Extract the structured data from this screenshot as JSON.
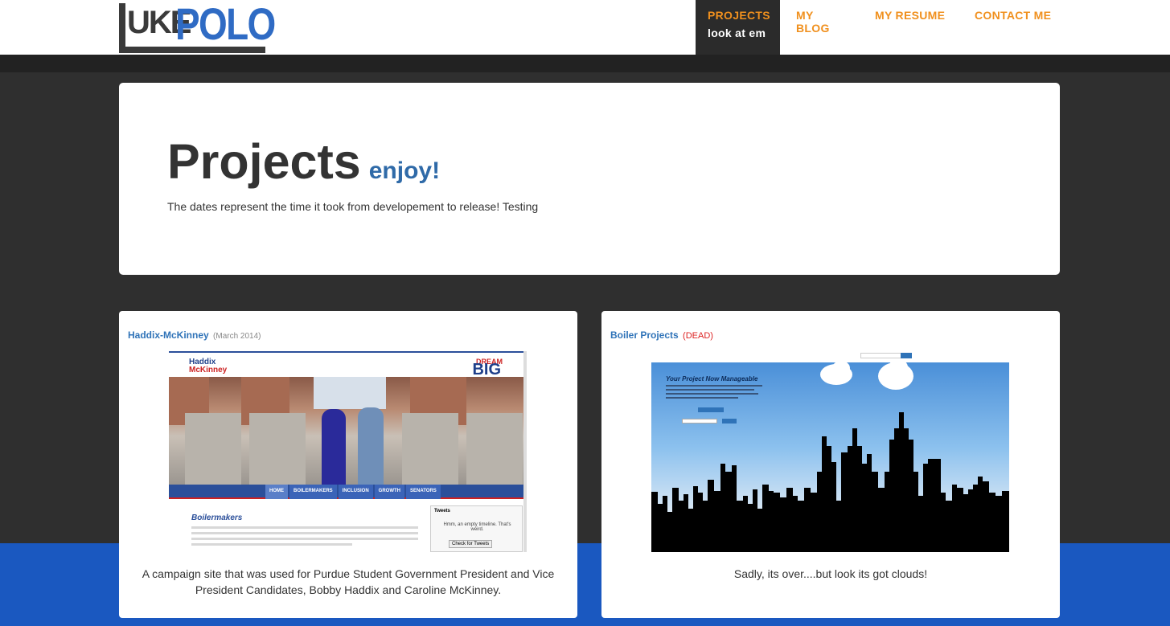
{
  "header": {
    "logo": {
      "part1": "UKE",
      "part2": "POLO"
    },
    "nav": [
      {
        "label": "PROJECTS",
        "sublabel": "look at em",
        "active": true
      },
      {
        "label": "MY BLOG"
      },
      {
        "label": "MY RESUME"
      },
      {
        "label": "CONTACT ME"
      }
    ]
  },
  "hero": {
    "title": "Projects",
    "subtitle": "enjoy!",
    "description": "The dates represent the time it took from developement to release! Testing"
  },
  "projects": [
    {
      "title": "Haddix-McKinney",
      "meta": "(March 2014)",
      "description": "A campaign site that was used for Purdue Student Government President and Vice President Candidates, Bobby Haddix and Caroline McKinney.",
      "screenshot": {
        "name_line1": "Haddix",
        "name_line2": "McKinney",
        "dream": "DREAM",
        "big": "BIG",
        "nav": [
          "HOME",
          "BOILERMAKERS",
          "INCLUSION",
          "GROWTH",
          "SENATORS"
        ],
        "section_title": "Boilermakers",
        "tweets_label": "Tweets",
        "tweets_empty": "Hmm, an empty timeline. That's weird.",
        "tweets_button": "Check for Tweets"
      }
    },
    {
      "title": "Boiler Projects",
      "meta": "(DEAD)",
      "description": "Sadly, its over....but look its got clouds!",
      "screenshot": {
        "headline": "Your Project Now Manageable"
      }
    }
  ],
  "colors": {
    "accent_orange": "#f0901e",
    "link_blue": "#2f73b8",
    "dead_red": "#d22222",
    "band_blue": "#1a58c0"
  }
}
